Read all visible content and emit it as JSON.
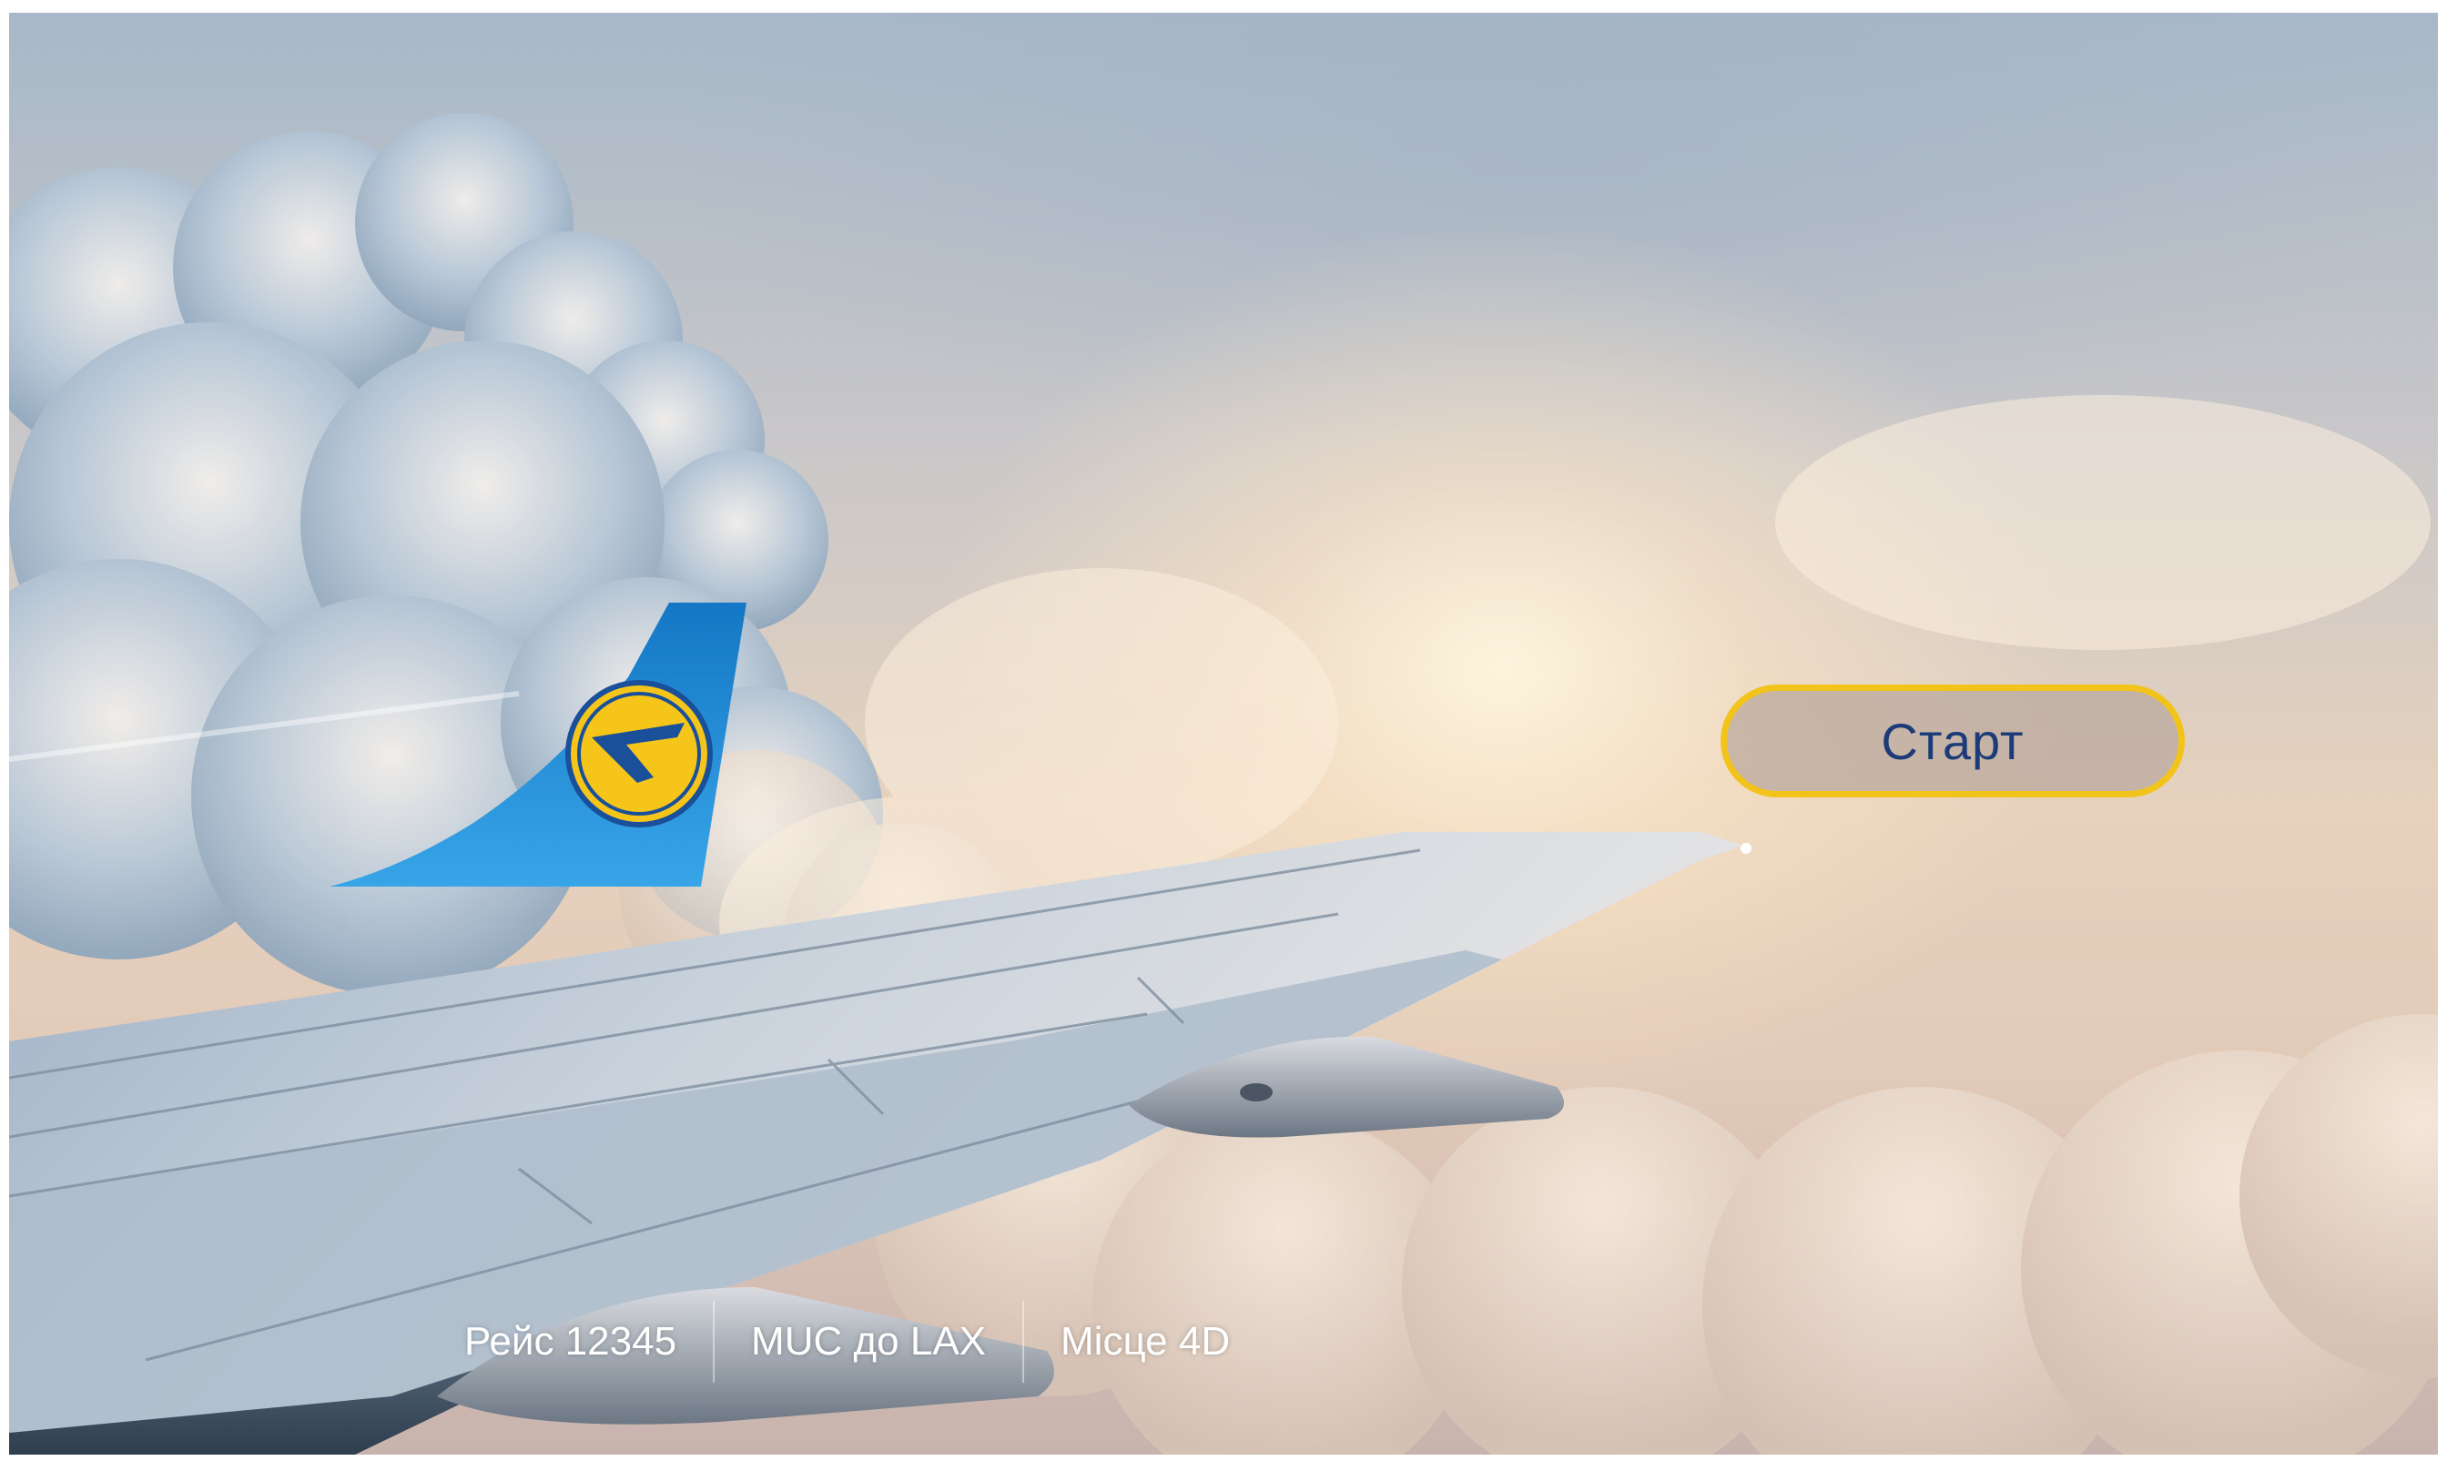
{
  "start_button": {
    "label": "Старт"
  },
  "flight_info": {
    "flight": "Рейс  12345",
    "route": "MUC до LAX",
    "seat": "Місце 4D"
  },
  "colors": {
    "button_border": "#f2c41b",
    "button_text": "#1c3b78",
    "tail_blue": "#1e8fd6",
    "logo_yellow": "#f6c51a"
  },
  "icons": {
    "airline_tail": "airline-tail-logo-icon"
  }
}
